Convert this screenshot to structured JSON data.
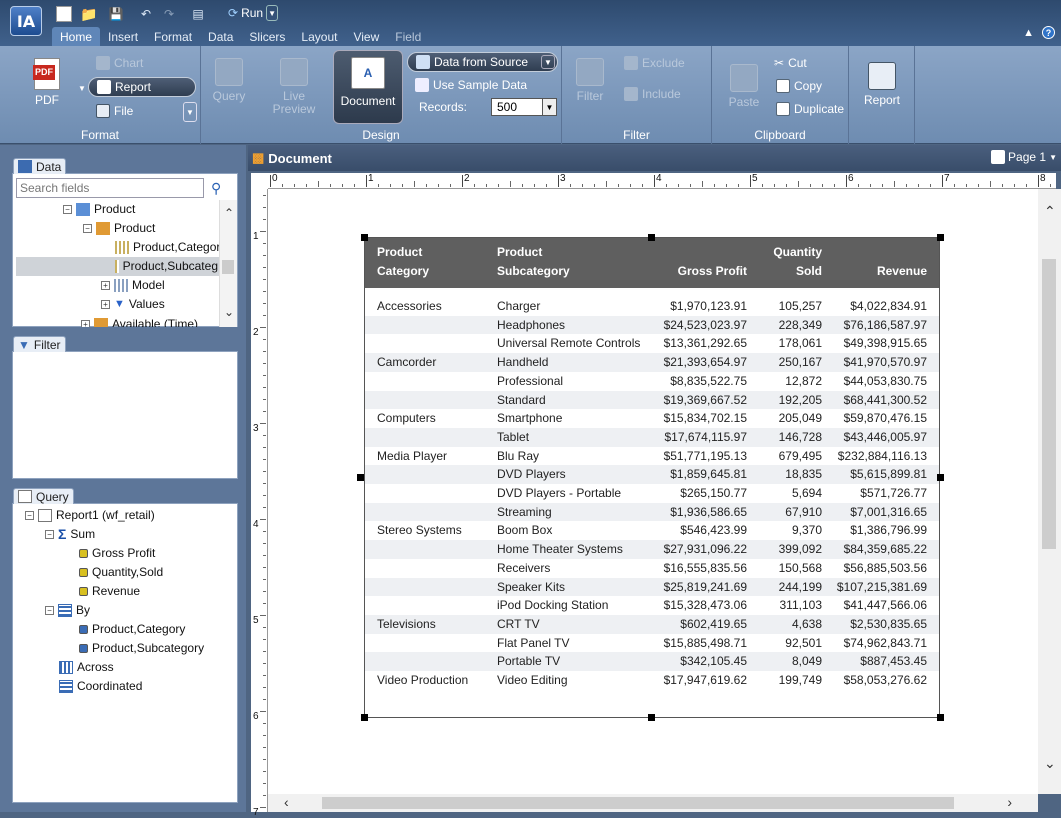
{
  "app": {
    "logo": "IA",
    "run_label": "Run"
  },
  "menu": [
    "Home",
    "Insert",
    "Format",
    "Data",
    "Slicers",
    "Layout",
    "View",
    "Field"
  ],
  "ribbon": {
    "format": {
      "label": "Format",
      "pdf": "PDF",
      "chart": "Chart",
      "report": "Report",
      "file": "File"
    },
    "design": {
      "label": "Design",
      "query": "Query",
      "live": "Live",
      "preview": "Preview",
      "document": "Document",
      "data_from_source": "Data from Source",
      "use_sample": "Use Sample Data",
      "records_label": "Records:",
      "records_value": "500"
    },
    "filter": {
      "label": "Filter",
      "filter": "Filter",
      "exclude": "Exclude",
      "include": "Include"
    },
    "clipboard": {
      "label": "Clipboard",
      "paste": "Paste",
      "cut": "Cut",
      "copy": "Copy",
      "duplicate": "Duplicate"
    },
    "report": {
      "label": "Report"
    }
  },
  "data_panel": {
    "title": "Data",
    "search_placeholder": "Search fields",
    "tree": [
      "Product",
      "Product",
      "Product,Category",
      "Product,Subcateg",
      "Model",
      "Values",
      "Available (Time)"
    ]
  },
  "filter_panel": {
    "title": "Filter"
  },
  "query_panel": {
    "title": "Query",
    "report": "Report1 (wf_retail)",
    "sum": "Sum",
    "sum_items": [
      "Gross Profit",
      "Quantity,Sold",
      "Revenue"
    ],
    "by": "By",
    "by_items": [
      "Product,Category",
      "Product,Subcategory"
    ],
    "across": "Across",
    "coordinated": "Coordinated"
  },
  "document": {
    "title": "Document",
    "page": "Page 1"
  },
  "ruler": {
    "h": [
      "0",
      "1",
      "2",
      "3",
      "4",
      "5",
      "6",
      "7",
      "8"
    ],
    "v": [
      "1",
      "2",
      "3",
      "4",
      "5",
      "6",
      "7"
    ]
  },
  "table": {
    "headers": {
      "cat1": "Product",
      "cat2": "Category",
      "sub1": "Product",
      "sub2": "Subcategory",
      "gp": "Gross Profit",
      "qty1": "Quantity",
      "qty2": "Sold",
      "rev": "Revenue"
    },
    "rows": [
      [
        "Accessories",
        "Charger",
        "$1,970,123.91",
        "105,257",
        "$4,022,834.91"
      ],
      [
        "",
        "Headphones",
        "$24,523,023.97",
        "228,349",
        "$76,186,587.97"
      ],
      [
        "",
        "Universal Remote Controls",
        "$13,361,292.65",
        "178,061",
        "$49,398,915.65"
      ],
      [
        "Camcorder",
        "Handheld",
        "$21,393,654.97",
        "250,167",
        "$41,970,570.97"
      ],
      [
        "",
        "Professional",
        "$8,835,522.75",
        "12,872",
        "$44,053,830.75"
      ],
      [
        "",
        "Standard",
        "$19,369,667.52",
        "192,205",
        "$68,441,300.52"
      ],
      [
        "Computers",
        "Smartphone",
        "$15,834,702.15",
        "205,049",
        "$59,870,476.15"
      ],
      [
        "",
        "Tablet",
        "$17,674,115.97",
        "146,728",
        "$43,446,005.97"
      ],
      [
        "Media Player",
        "Blu Ray",
        "$51,771,195.13",
        "679,495",
        "$232,884,116.13"
      ],
      [
        "",
        "DVD Players",
        "$1,859,645.81",
        "18,835",
        "$5,615,899.81"
      ],
      [
        "",
        "DVD Players - Portable",
        "$265,150.77",
        "5,694",
        "$571,726.77"
      ],
      [
        "",
        "Streaming",
        "$1,936,586.65",
        "67,910",
        "$7,001,316.65"
      ],
      [
        "Stereo Systems",
        "Boom Box",
        "$546,423.99",
        "9,370",
        "$1,386,796.99"
      ],
      [
        "",
        "Home Theater Systems",
        "$27,931,096.22",
        "399,092",
        "$84,359,685.22"
      ],
      [
        "",
        "Receivers",
        "$16,555,835.56",
        "150,568",
        "$56,885,503.56"
      ],
      [
        "",
        "Speaker Kits",
        "$25,819,241.69",
        "244,199",
        "$107,215,381.69"
      ],
      [
        "",
        "iPod Docking Station",
        "$15,328,473.06",
        "311,103",
        "$41,447,566.06"
      ],
      [
        "Televisions",
        "CRT TV",
        "$602,419.65",
        "4,638",
        "$2,530,835.65"
      ],
      [
        "",
        "Flat Panel TV",
        "$15,885,498.71",
        "92,501",
        "$74,962,843.71"
      ],
      [
        "",
        "Portable TV",
        "$342,105.45",
        "8,049",
        "$887,453.45"
      ],
      [
        "Video Production",
        "Video Editing",
        "$17,947,619.62",
        "199,749",
        "$58,053,276.62"
      ]
    ]
  }
}
